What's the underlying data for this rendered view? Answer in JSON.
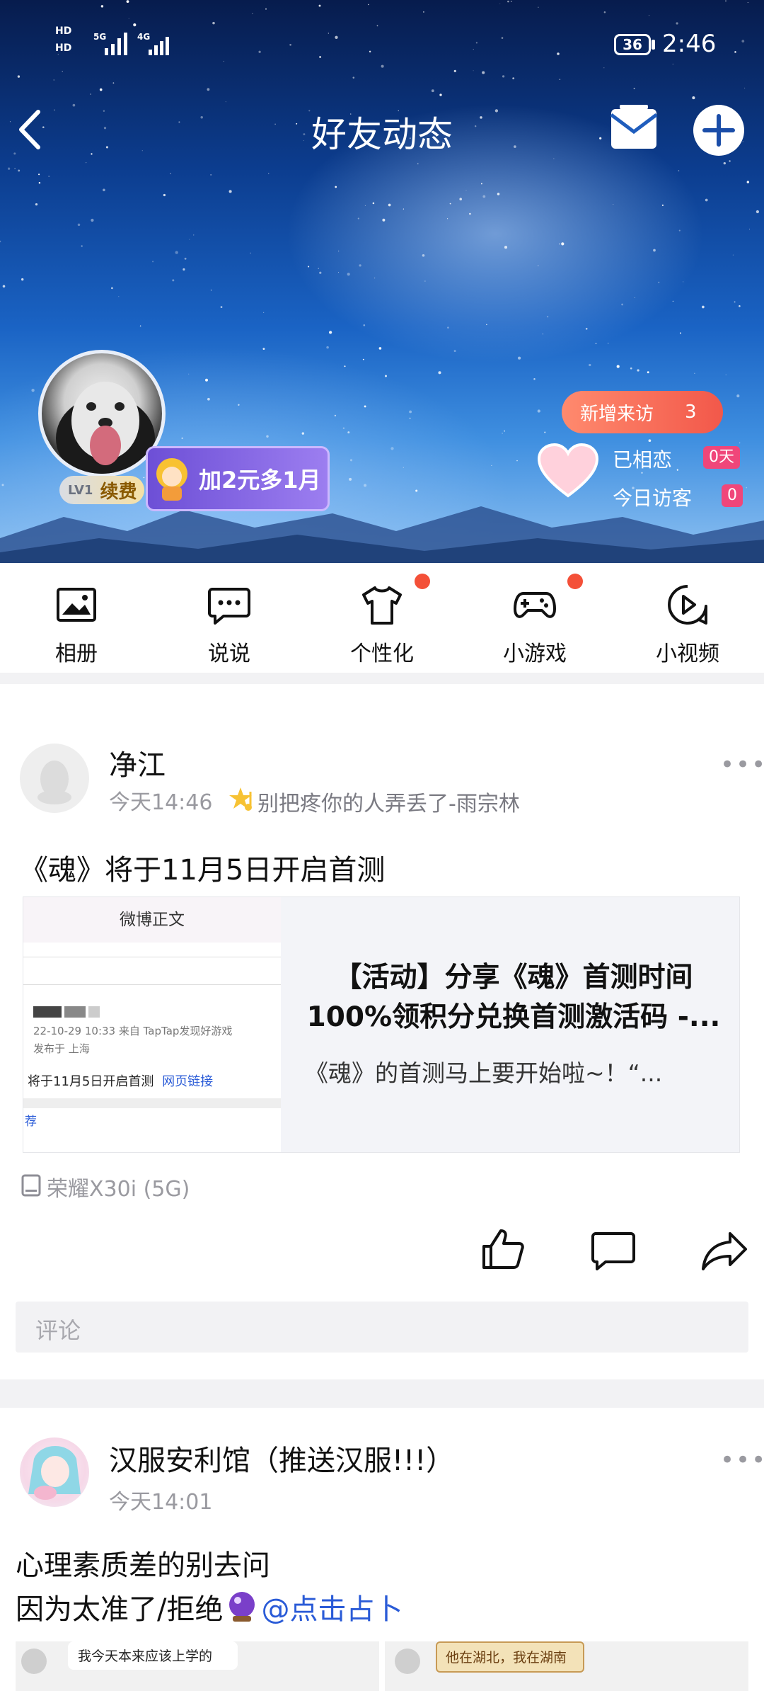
{
  "status_bar": {
    "signal_left_1": "HD",
    "signal_left_2": "HD",
    "net1": "5G",
    "net2": "4G",
    "battery": "36",
    "time": "2:46"
  },
  "header": {
    "title": "好友动态",
    "back_icon": "chevron-left-icon",
    "mail_icon": "mail-icon",
    "add_icon": "plus-circle-icon"
  },
  "profile": {
    "level": "LV1",
    "renew_label": "续费",
    "promo": "加2元多1月",
    "new_visitors_label": "新增来访",
    "new_visitors_count": "3",
    "in_love_label": "已相恋",
    "in_love_days": "0天",
    "today_visitors_label": "今日访客",
    "today_visitors_count": "0"
  },
  "menu": [
    {
      "label": "相册",
      "icon": "photo-icon",
      "dot": false
    },
    {
      "label": "说说",
      "icon": "chat-bubble-icon",
      "dot": false
    },
    {
      "label": "个性化",
      "icon": "tshirt-icon",
      "dot": true
    },
    {
      "label": "小游戏",
      "icon": "gamepad-icon",
      "dot": true
    },
    {
      "label": "小视频",
      "icon": "video-play-icon",
      "dot": false
    }
  ],
  "posts": [
    {
      "author": "净江",
      "time": "今天14:46",
      "signature": "别把疼你的人弄丢了-雨宗林",
      "text": "《魂》将于11月5日开启首测",
      "link_card": {
        "thumb_header": "微博正文",
        "thumb_line1": "22-10-29 10:33  来自 TapTap发现好游戏",
        "thumb_line2": "发布于 上海",
        "thumb_line3": "将于11月5日开启首测",
        "thumb_link": "网页链接",
        "thumb_line4": "荐",
        "title": "【活动】分享《魂》首测时间100%领积分兑换首测激活码 -...",
        "desc": "《魂》的首测马上要开始啦~！“..."
      },
      "device": "荣耀X30i (5G)",
      "comment_placeholder": "评论"
    },
    {
      "author": "汉服安利馆（推送汉服!!!）",
      "time": "今天14:01",
      "text_line1": "心理素质差的别去问",
      "text_line2_a": "因为太准了/拒绝",
      "text_line2_link": "@点击占卜",
      "img1_text": "我今天本来应该上学的",
      "img2_text": "他在湖北，我在湖南"
    }
  ],
  "colors": {
    "accent_red": "#f45038",
    "link_blue": "#2a5bd7",
    "promo_purple": "#7b57d8"
  }
}
